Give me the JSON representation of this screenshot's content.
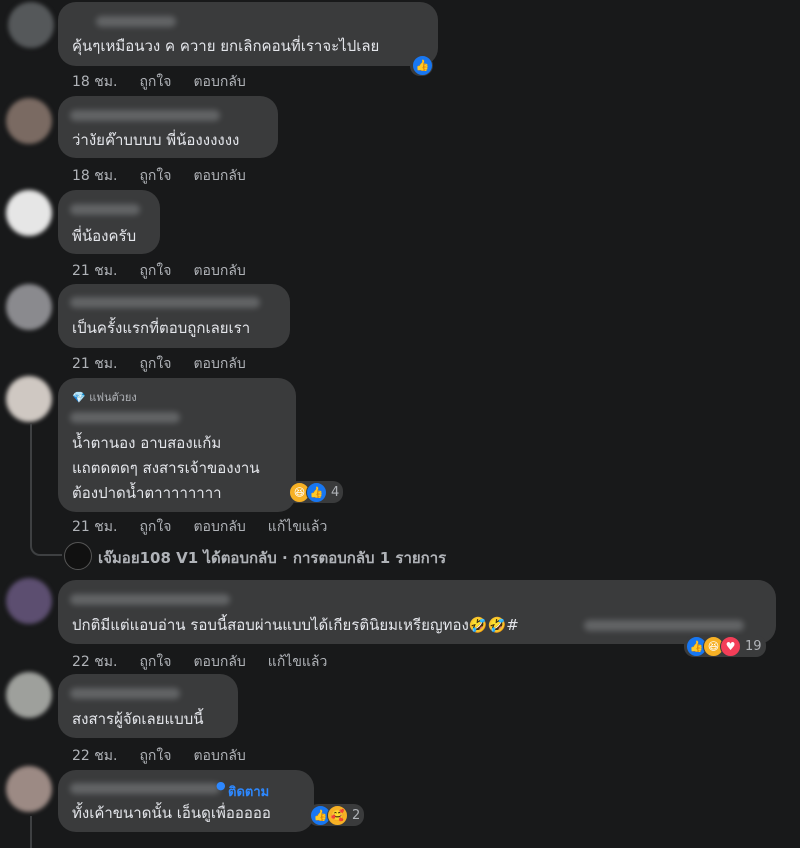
{
  "actions": {
    "like": "ถูกใจ",
    "reply": "ตอบกลับ",
    "edited": "แก้ไขแล้ว"
  },
  "comments": [
    {
      "text": "คุ้นๆเหมือนวง ค ควาย ยกเลิกคอนที่เราจะไปเลย",
      "time": "18 ชม."
    },
    {
      "text": "ว่างัยค๊าบบบบ พี่น้องงงงงง",
      "time": "18 ชม."
    },
    {
      "text": "พี่น้องครับ",
      "time": "21 ชม."
    },
    {
      "text": "เป็นครั้งแรกที่ตอบถูกเลยเรา",
      "time": "21 ชม."
    },
    {
      "badge": "แฟนตัวยง",
      "lines": [
        "น้ำตานอง อาบสองแก้ม",
        "แถตดตดๆ สงสารเจ้าของงาน",
        "ต้องปาดน้ำตาาาาาาาา"
      ],
      "time": "21 ชม.",
      "reaction_count": "4",
      "reply_summary": "เจ๊มอย108 V1 ได้ตอบกลับ · การตอบกลับ 1 รายการ"
    },
    {
      "text": "ปกติมีแต่แอบอ่าน รอบนี้สอบผ่านแบบได้เกียรตินิยมเหรียญทอง🤣🤣#",
      "time": "22 ชม.",
      "reaction_count": "19"
    },
    {
      "text": "สงสารผู้จัดเลยแบบนี้",
      "time": "22 ชม."
    },
    {
      "follow": "ติดตาม",
      "text": "ทั้งเค้าขนาดนั้น เอ็นดูเพื่อออออ",
      "reaction_count": "2"
    }
  ],
  "colors": {
    "background": "#18191a",
    "bubble": "#3a3b3c",
    "text": "#e4e6eb",
    "muted": "#b0b3b8",
    "link": "#2d88ff",
    "like": "#1877f2",
    "love": "#f33e58",
    "haha": "#f7b125"
  },
  "icons": {
    "like": "like-icon",
    "haha": "haha-emoji-icon",
    "love": "heart-icon",
    "care": "care-emoji-icon",
    "badge": "diamond-icon"
  }
}
